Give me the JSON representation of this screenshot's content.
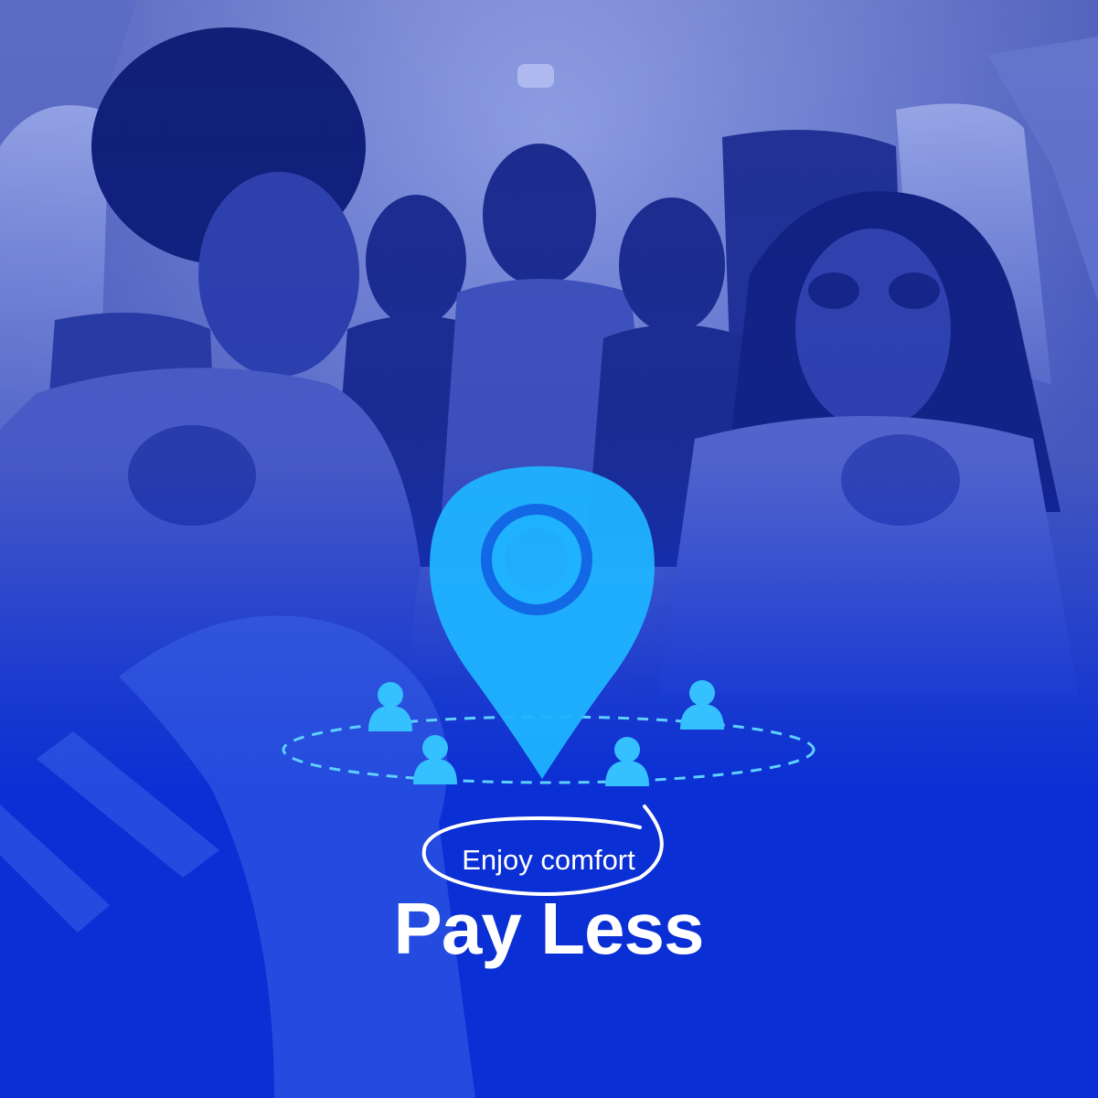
{
  "headline": {
    "small": "Enjoy comfort",
    "big": "Pay Less"
  },
  "icons": {
    "pin": "location-pin-icon",
    "person": "person-icon"
  },
  "colors": {
    "background_blue": "#0a2fd4",
    "pin_cyan": "#1fb3ff",
    "text_white": "#ffffff"
  }
}
